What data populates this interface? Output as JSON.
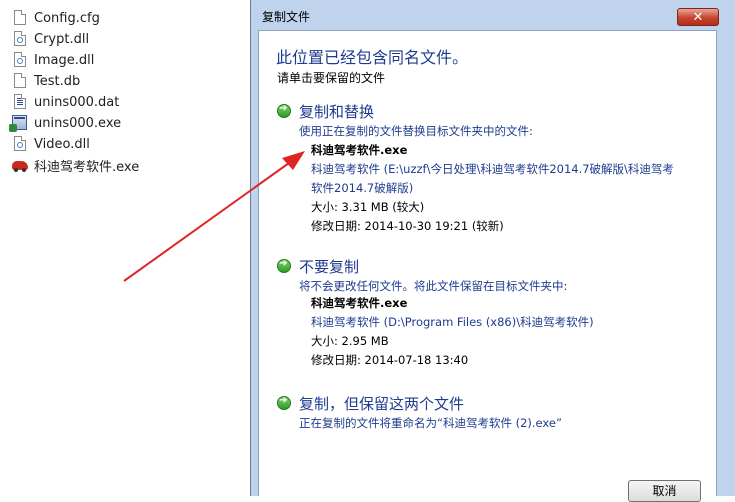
{
  "explorer": {
    "files": [
      {
        "name": "Config.cfg",
        "icon": "document-icon",
        "type": "doc"
      },
      {
        "name": "Crypt.dll",
        "icon": "dll-icon",
        "type": "dll"
      },
      {
        "name": "Image.dll",
        "icon": "dll-icon",
        "type": "dll"
      },
      {
        "name": "Test.db",
        "icon": "document-icon",
        "type": "doc"
      },
      {
        "name": "unins000.dat",
        "icon": "data-file-icon",
        "type": "dat"
      },
      {
        "name": "unins000.exe",
        "icon": "installer-icon",
        "type": "exe"
      },
      {
        "name": "Video.dll",
        "icon": "dll-icon",
        "type": "dll"
      },
      {
        "name": "科迪驾考软件.exe",
        "icon": "car-app-icon",
        "type": "car"
      }
    ]
  },
  "dialog": {
    "title": "复制文件",
    "close_label": "✕",
    "heading": "此位置已经包含同名文件。",
    "subheading": "请单击要保留的文件",
    "options": {
      "replace": {
        "title": "复制和替换",
        "description": "使用正在复制的文件替换目标文件夹中的文件:",
        "file": {
          "name": "科迪驾考软件.exe",
          "path_line1": "科迪驾考软件 (E:\\uzzf\\今日处理\\科迪驾考软件2014.7破解版\\科迪驾考",
          "path_line2": "软件2014.7破解版)",
          "size": "大小: 3.31 MB (较大)",
          "date": "修改日期: 2014-10-30 19:21 (较新)"
        }
      },
      "dont_copy": {
        "title": "不要复制",
        "description": "将不会更改任何文件。将此文件保留在目标文件夹中:",
        "file": {
          "name": "科迪驾考软件.exe",
          "path_line1": "科迪驾考软件 (D:\\Program Files (x86)\\科迪驾考软件)",
          "size": "大小: 2.95 MB",
          "date": "修改日期: 2014-07-18 13:40"
        }
      },
      "keep_both": {
        "title": "复制，但保留这两个文件",
        "description": "正在复制的文件将重命名为“科迪驾考软件 (2).exe”"
      }
    },
    "cancel_label": "取消"
  },
  "colors": {
    "accent_text": "#1e3b8f",
    "dialog_frame": "#bfd4ec",
    "close_button": "#c7442f",
    "annotation_arrow": "#e02424"
  }
}
